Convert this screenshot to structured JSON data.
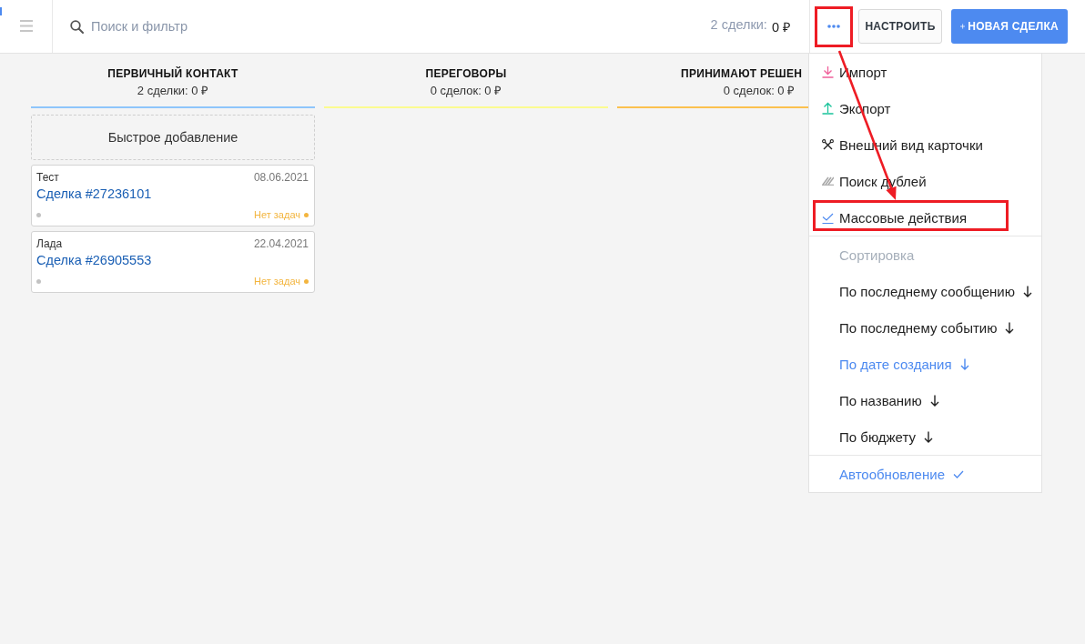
{
  "topbar": {
    "search": {
      "placeholder": "Поиск и фильтр"
    },
    "summary": {
      "count": "2 сделки:",
      "total": "0 ₽"
    },
    "more_button": {
      "highlighted": true
    },
    "buttons": [
      {
        "kind": "secondary",
        "label": "НАСТРОИТЬ"
      },
      {
        "kind": "primary",
        "label": "НОВАЯ СДЕЛКА"
      }
    ]
  },
  "columns": [
    {
      "title": "ПЕРВИЧНЫЙ КОНТАКТ",
      "summary": "2 сделки: 0 ₽",
      "color": "#8ec5fb",
      "quick_add": "Быстрое добавление",
      "cards": [
        {
          "name": "Тест",
          "date": "08.06.2021",
          "title": "Сделка #27236101",
          "tasks": "Нет задач"
        },
        {
          "name": "Лада",
          "date": "22.04.2021",
          "title": "Сделка #26905553",
          "tasks": "Нет задач"
        }
      ]
    },
    {
      "title": "ПЕРЕГОВОРЫ",
      "summary": "0 сделок: 0 ₽",
      "color": "#fbfb8f"
    },
    {
      "title": "ПРИНИМАЮТ РЕШЕН",
      "summary": "0 сделок: 0 ₽",
      "color": "#fbc14e"
    }
  ],
  "menu": {
    "open": true,
    "actions": [
      {
        "label": "Импорт",
        "highlighted": false
      },
      {
        "label": "Экспорт",
        "highlighted": false
      },
      {
        "label": "Внешний вид карточки",
        "highlighted": false
      },
      {
        "label": "Поиск дублей",
        "highlighted": false
      },
      {
        "label": "Массовые действия",
        "highlighted": true
      }
    ],
    "sort_heading": "Сортировка",
    "sort_options": [
      {
        "label": "По последнему сообщению",
        "selected": false
      },
      {
        "label": "По последнему событию",
        "selected": false
      },
      {
        "label": "По дате создания",
        "selected": true
      },
      {
        "label": "По названию",
        "selected": false
      },
      {
        "label": "По бюджету",
        "selected": false
      }
    ],
    "auto_update": {
      "label": "Автообновление",
      "checked": true
    }
  },
  "callout_arrow": true
}
